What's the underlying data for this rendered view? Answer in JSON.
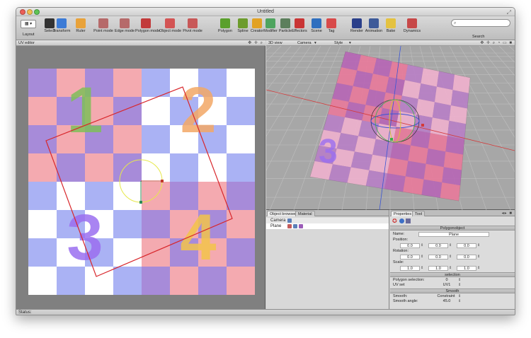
{
  "window": {
    "title": "Untitled"
  },
  "toolbar": {
    "layout_label": "Layout",
    "layout_value": "▦ ▾",
    "items": [
      {
        "label": "Select",
        "icon": "cursor-icon",
        "color": "#333333"
      },
      {
        "label": "Transform",
        "icon": "transform-icon",
        "color": "#3c7bd6"
      },
      {
        "label": "Ruler",
        "icon": "ruler-icon",
        "color": "#e8a23a"
      },
      {
        "label": "Point mode",
        "icon": "point-mode-icon",
        "color": "#b66a6a"
      },
      {
        "label": "Edge mode",
        "icon": "edge-mode-icon",
        "color": "#b66a6a"
      },
      {
        "label": "Polygon mode",
        "icon": "polygon-mode-icon",
        "color": "#c23b3b"
      },
      {
        "label": "Object mode",
        "icon": "object-mode-icon",
        "color": "#d35454"
      },
      {
        "label": "Pivot mode",
        "icon": "pivot-mode-icon",
        "color": "#c85858"
      },
      {
        "label": "Polygon",
        "icon": "polygon-tool-icon",
        "color": "#5aa02c"
      },
      {
        "label": "Spline",
        "icon": "spline-icon",
        "color": "#6d9c2d"
      },
      {
        "label": "Creator",
        "icon": "creator-icon",
        "color": "#e2a224"
      },
      {
        "label": "Modifier",
        "icon": "modifier-icon",
        "color": "#4fa45f"
      },
      {
        "label": "Particle",
        "icon": "particle-icon",
        "color": "#5c7f5c"
      },
      {
        "label": "Effectors",
        "icon": "effectors-icon",
        "color": "#c93535"
      },
      {
        "label": "Scene",
        "icon": "scene-icon",
        "color": "#2f6fbf"
      },
      {
        "label": "Tag",
        "icon": "tag-icon",
        "color": "#d84a4a"
      },
      {
        "label": "Render",
        "icon": "render-icon",
        "color": "#2a3f8a"
      },
      {
        "label": "Animation",
        "icon": "animation-icon",
        "color": "#3d5a99"
      },
      {
        "label": "Bake",
        "icon": "bake-icon",
        "color": "#e4c240"
      },
      {
        "label": "Dynamics",
        "icon": "dynamics-icon",
        "color": "#c74848"
      }
    ],
    "search_placeholder": "",
    "search_label": "Search"
  },
  "uv_editor": {
    "title": "UV editor",
    "numbers": [
      "1",
      "2",
      "3",
      "4"
    ],
    "colors": {
      "purple": "#a78bd9",
      "pink": "#f4aab0",
      "blue": "#aab2f4",
      "white": "#ffffff",
      "num1": "#7fbf5a",
      "num2": "#f3a866",
      "num3": "#9b6ff0",
      "num4": "#f3c44b",
      "frame": "#d8262b",
      "circle": "#e7e84a"
    }
  },
  "view3d": {
    "title": "3D view",
    "camera_label": "Camera",
    "style_label": "Style"
  },
  "object_browser": {
    "tabs": [
      "Object browser",
      "Material"
    ],
    "objects": [
      {
        "name": "Camera"
      },
      {
        "name": "Plane"
      }
    ]
  },
  "properties": {
    "tabs": [
      "Properties",
      "Tool"
    ],
    "object_title": "Polygonobject",
    "name_label": "Name:",
    "name_value": "Plane",
    "position_label": "Position:",
    "position": [
      "0.0",
      "0.0",
      "0.0"
    ],
    "rotation_label": "Rotation:",
    "rotation": [
      "0.0",
      "0.0",
      "0.0"
    ],
    "scale_label": "Scale:",
    "scale": [
      "1.0",
      "1.0",
      "1.0"
    ],
    "selection_section": "selection",
    "polygon_selection_label": "Polygon selection:",
    "polygon_selection_value": "0",
    "uv_set_label": "UV set",
    "uv_set_value": "UV1",
    "smooth_section": "Smooth",
    "smooth_label": "Smooth:",
    "smooth_value": "Constraint",
    "smooth_angle_label": "Smooth angle:",
    "smooth_angle_value": "45.0"
  },
  "status": {
    "text": "Status:"
  }
}
